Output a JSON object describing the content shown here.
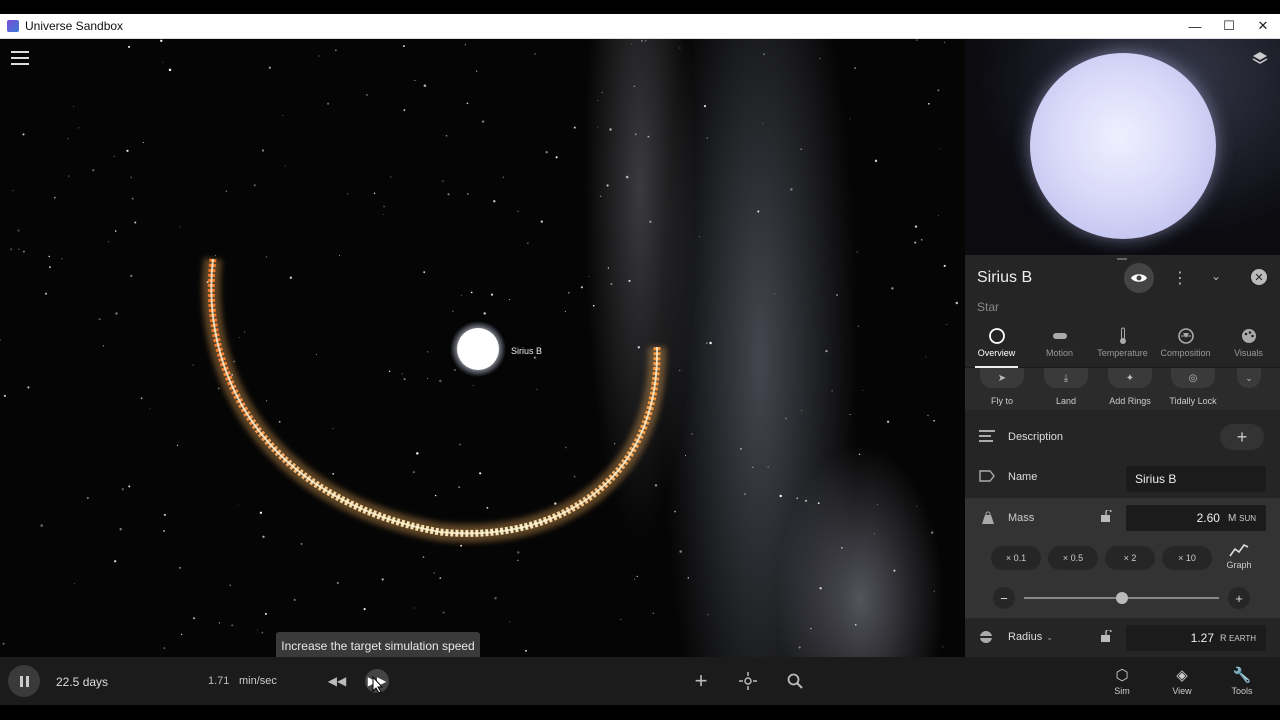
{
  "window": {
    "title": "Universe Sandbox",
    "minimize": "—",
    "maximize": "☐",
    "close": "✕"
  },
  "viewport": {
    "object_label": "Sirius B",
    "tooltip": "Increase the target simulation speed"
  },
  "bottombar": {
    "sim_time": "22.5 days",
    "speed_value": "1.71",
    "speed_unit": "min/sec",
    "rewind": "◀◀",
    "fast_forward": "▶▶",
    "add": "+",
    "tools": [
      {
        "label": "Sim",
        "icon": "cube-icon"
      },
      {
        "label": "View",
        "icon": "layers-icon"
      },
      {
        "label": "Tools",
        "icon": "wrench-icon"
      }
    ]
  },
  "panel": {
    "object_name": "Sirius B",
    "object_type": "Star",
    "kebab": "⋮",
    "chevron": "⌄",
    "close": "✕",
    "tabs": [
      {
        "label": "Overview",
        "icon": "circle-icon"
      },
      {
        "label": "Motion",
        "icon": "motion-icon"
      },
      {
        "label": "Temperature",
        "icon": "thermometer-icon"
      },
      {
        "label": "Composition",
        "icon": "composition-icon"
      },
      {
        "label": "Visuals",
        "icon": "palette-icon"
      }
    ],
    "actions": [
      {
        "label": "Fly to",
        "icon": "fly-icon"
      },
      {
        "label": "Land",
        "icon": "land-icon"
      },
      {
        "label": "Add Rings",
        "icon": "rings-icon"
      },
      {
        "label": "Tidally Lock",
        "icon": "lock-orbit-icon"
      }
    ],
    "more": "⌄",
    "description": {
      "label": "Description",
      "add": "+"
    },
    "name": {
      "label": "Name",
      "value": "Sirius B"
    },
    "mass": {
      "label": "Mass",
      "value": "2.60",
      "unit_main": "M",
      "unit_sub": "SUN",
      "multipliers": [
        "× 0.1",
        "× 0.5",
        "× 2",
        "× 10"
      ],
      "graph_label": "Graph",
      "minus": "−",
      "plus": "+",
      "slider_fraction": 0.5
    },
    "radius": {
      "label": "Radius",
      "value": "1.27",
      "unit_main": "R",
      "unit_sub": "EARTH",
      "dropdown": "⌄"
    }
  }
}
